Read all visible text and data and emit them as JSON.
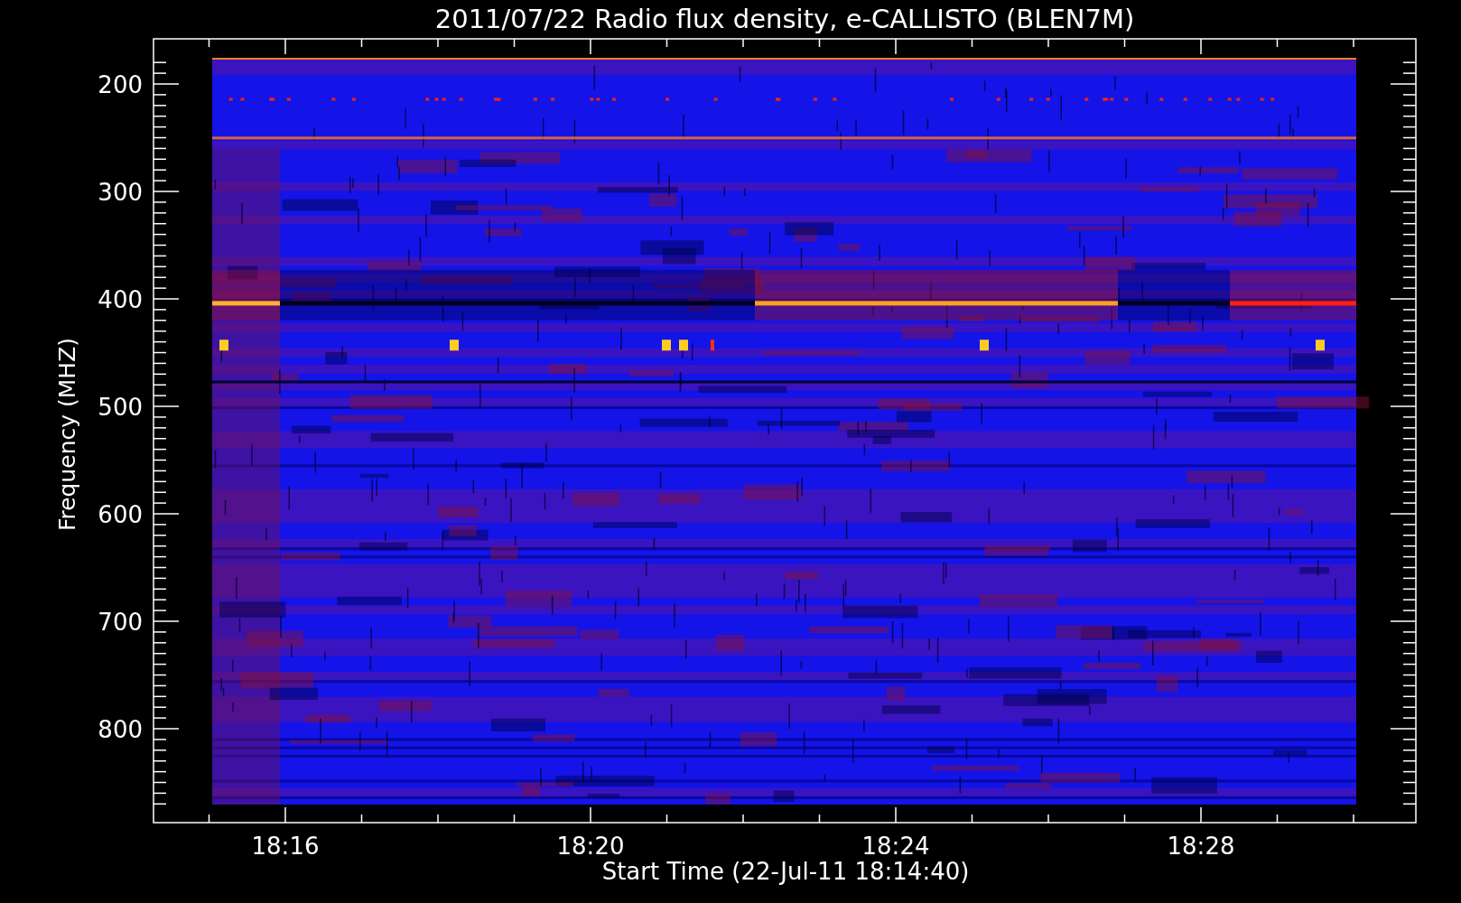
{
  "plot": {
    "title": "2011/07/22  Radio flux density, e-CALLISTO (BLEN7M)",
    "ylabel": "Frequency (MHZ)",
    "xlabel": "Start Time (22-Jul-11 18:14:40)",
    "yticks": [
      "200",
      "300",
      "400",
      "500",
      "600",
      "700",
      "800"
    ],
    "xticks": [
      "18:16",
      "18:20",
      "18:24",
      "18:28"
    ]
  }
}
